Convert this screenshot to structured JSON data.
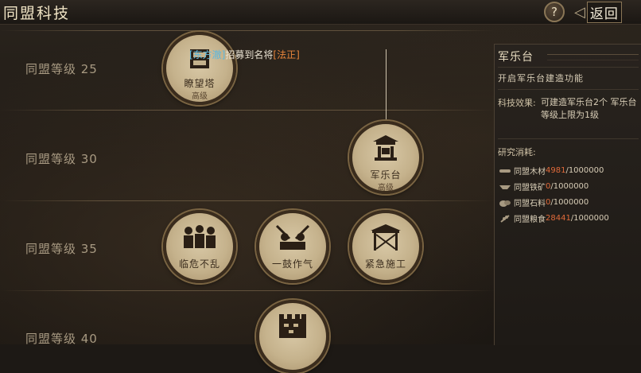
{
  "header": {
    "title": "同盟科技",
    "help_label": "?",
    "back_label": "返回",
    "back_arrow": "◁"
  },
  "levels": [
    {
      "label": "同盟等级 25"
    },
    {
      "label": "同盟等级 30"
    },
    {
      "label": "同盟等级 35"
    },
    {
      "label": "同盟等级 40"
    }
  ],
  "notice": {
    "general1": "[东方澈]",
    "mid": "招募到名将",
    "general2": "[法正]"
  },
  "nodes": [
    {
      "name": "瞭望塔",
      "sub": "高级",
      "icon": "watchtower-icon"
    },
    {
      "name": "军乐台",
      "sub": "高级",
      "icon": "pavilion-icon"
    },
    {
      "name": "临危不乱",
      "icon": "soldiers-icon"
    },
    {
      "name": "一鼓作气",
      "icon": "charge-icon"
    },
    {
      "name": "紧急施工",
      "icon": "scaffold-icon"
    },
    {
      "name": "",
      "icon": "wall-icon"
    }
  ],
  "panel": {
    "title": "军乐台",
    "description": "开启军乐台建造功能",
    "effect_label": "科技效果:",
    "effect_text": "可建造军乐台2个 军乐台等级上限为1级",
    "cost_label": "研究消耗:",
    "costs": [
      {
        "name": "同盟木材",
        "current": "4981",
        "total": "/1000000",
        "icon": "wood-icon"
      },
      {
        "name": "同盟铁矿",
        "current": "0",
        "total": "/1000000",
        "icon": "iron-icon"
      },
      {
        "name": "同盟石料",
        "current": "0",
        "total": "/1000000",
        "icon": "stone-icon"
      },
      {
        "name": "同盟粮食",
        "current": "28441",
        "total": "/1000000",
        "icon": "grain-icon"
      }
    ]
  },
  "colors": {
    "accent_blue": "#5bb8e0",
    "accent_orange": "#e7843a",
    "cost_red": "#e06a3a"
  }
}
